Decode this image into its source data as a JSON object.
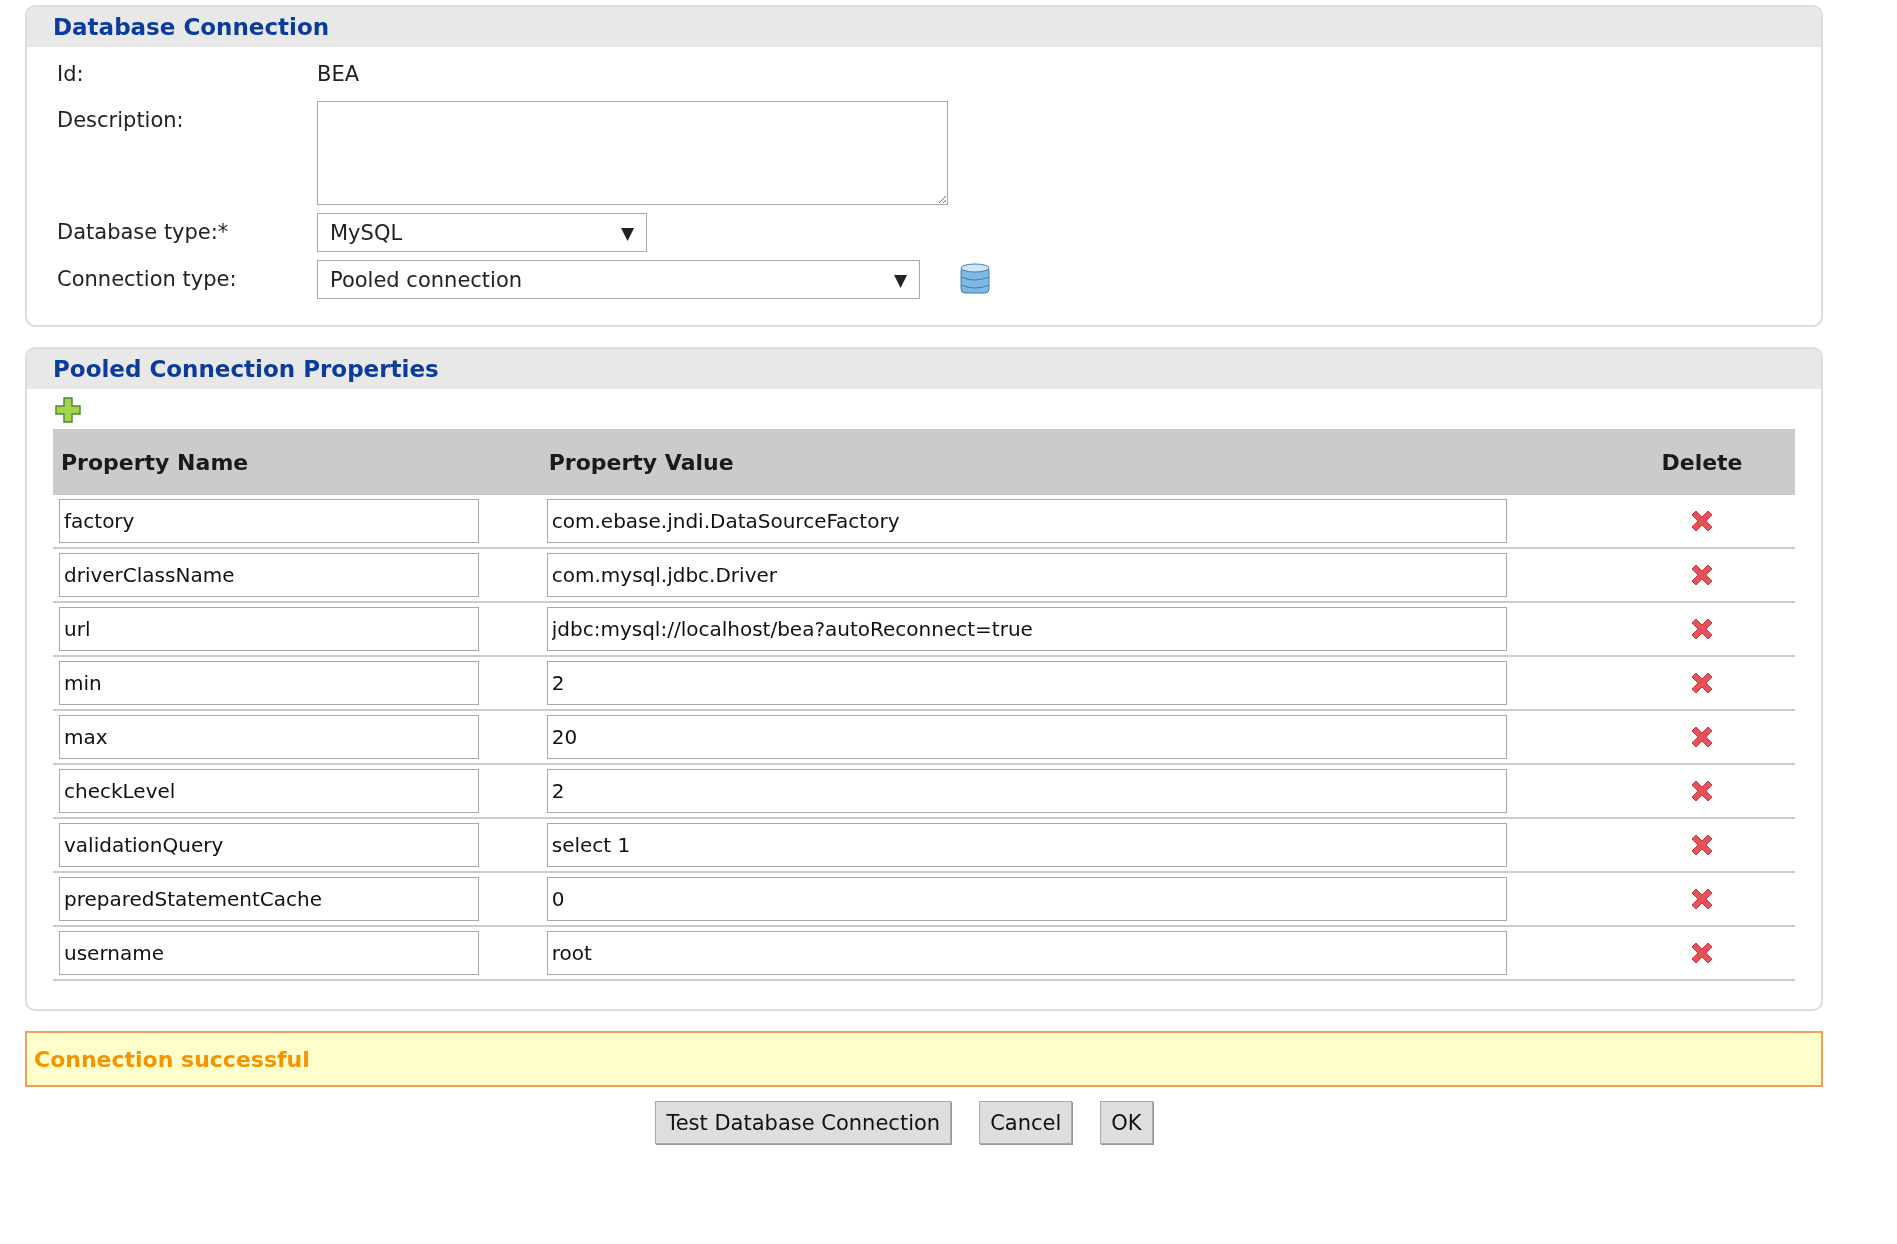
{
  "connection_panel": {
    "title": "Database Connection",
    "fields": [
      {
        "kind": "text",
        "label": "Id:",
        "value": "BEA"
      },
      {
        "kind": "textarea",
        "label": "Description:"
      },
      {
        "kind": "select",
        "label": "Database type:*",
        "value": "MySQL",
        "caret": "▼"
      },
      {
        "kind": "wideselect",
        "label": "Connection type:",
        "value": "Pooled connection",
        "caret": "▼",
        "icon": true
      }
    ]
  },
  "properties_panel": {
    "title": "Pooled Connection Properties",
    "table": {
      "columns": [
        "Property Name",
        "Property Value",
        "Delete"
      ],
      "rows": [
        {
          "name": "factory",
          "value": "com.ebase.jndi.DataSourceFactory"
        },
        {
          "name": "driverClassName",
          "value": "com.mysql.jdbc.Driver"
        },
        {
          "name": "url",
          "value": "jdbc:mysql://localhost/bea?autoReconnect=true"
        },
        {
          "name": "min",
          "value": "2"
        },
        {
          "name": "max",
          "value": "20"
        },
        {
          "name": "checkLevel",
          "value": "2"
        },
        {
          "name": "validationQuery",
          "value": "select 1"
        },
        {
          "name": "preparedStatementCache",
          "value": "0"
        },
        {
          "name": "username",
          "value": "root"
        }
      ]
    }
  },
  "status_message": "Connection successful",
  "buttons": [
    "Test Database Connection",
    "Cancel",
    "OK"
  ]
}
